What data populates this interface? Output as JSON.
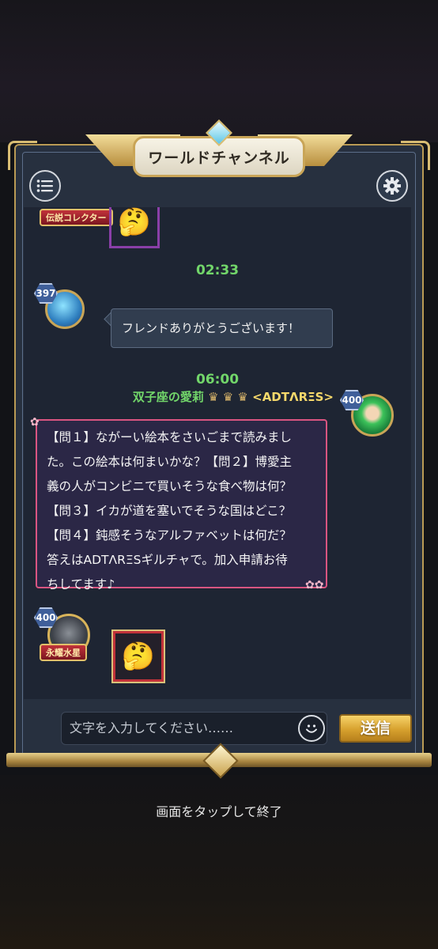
{
  "header": {
    "title": "ワールドチャンネル"
  },
  "toolbar": {
    "menu_icon": "list-icon",
    "settings_icon": "gear-icon"
  },
  "chat": {
    "messages": [
      {
        "type": "sticker",
        "badge": "伝説コレクター",
        "emoji": "🤔"
      },
      {
        "time": "02:33",
        "level": "397",
        "text": "フレンドありがとうございます！"
      },
      {
        "time": "06:00",
        "level": "400",
        "name": "双子座の愛莉",
        "guild": "<ADTΛRΞS>",
        "lines": [
          "【問１】ながーい絵本をさいごまで読みまし",
          "た。この絵本は何まいかな？【問２】博愛主",
          "義の人がコンビニで買いそうな食べ物は何？",
          "【問３】イカが道を塞いでそうな国はどこ？",
          "【問４】鈍感そうなアルファベットは何だ？",
          "答えはADTΛRΞSギルチャで。加入申請お待",
          "ちしてます♪"
        ]
      },
      {
        "type": "sticker",
        "level": "400",
        "badge": "永耀水星",
        "emoji": "🤔"
      }
    ]
  },
  "input": {
    "placeholder": "文字を入力してください……",
    "send_label": "送信"
  },
  "footer": {
    "hint": "画面をタップして終了"
  }
}
